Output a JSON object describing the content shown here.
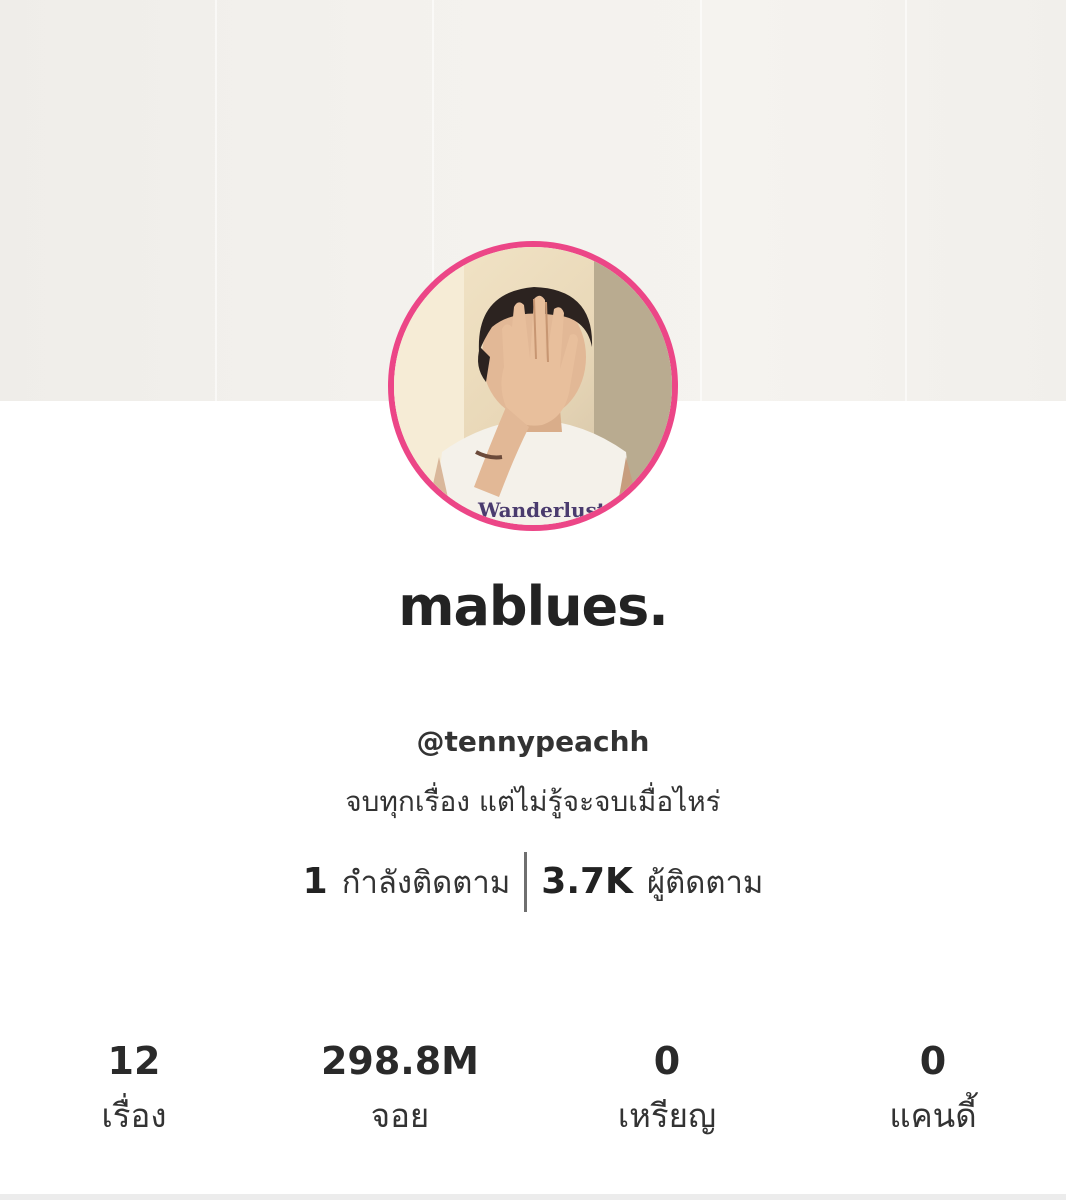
{
  "profile": {
    "display_name": "mablues.",
    "handle": "@tennypeachh",
    "bio": "จบทุกเรื่อง แต่ไม่รู้จะจบเมื่อไหร่",
    "avatar_border_color": "#ec4687",
    "avatar_shirt_text": "Wanderlust"
  },
  "follow": {
    "following_count": "1",
    "following_label": "กำลังติดตาม",
    "followers_count": "3.7K",
    "followers_label": "ผู้ติดตาม"
  },
  "stats": [
    {
      "value": "12",
      "label": "เรื่อง"
    },
    {
      "value": "298.8M",
      "label": "จอย"
    },
    {
      "value": "0",
      "label": "เหรียญ"
    },
    {
      "value": "0",
      "label": "แคนดี้"
    }
  ]
}
